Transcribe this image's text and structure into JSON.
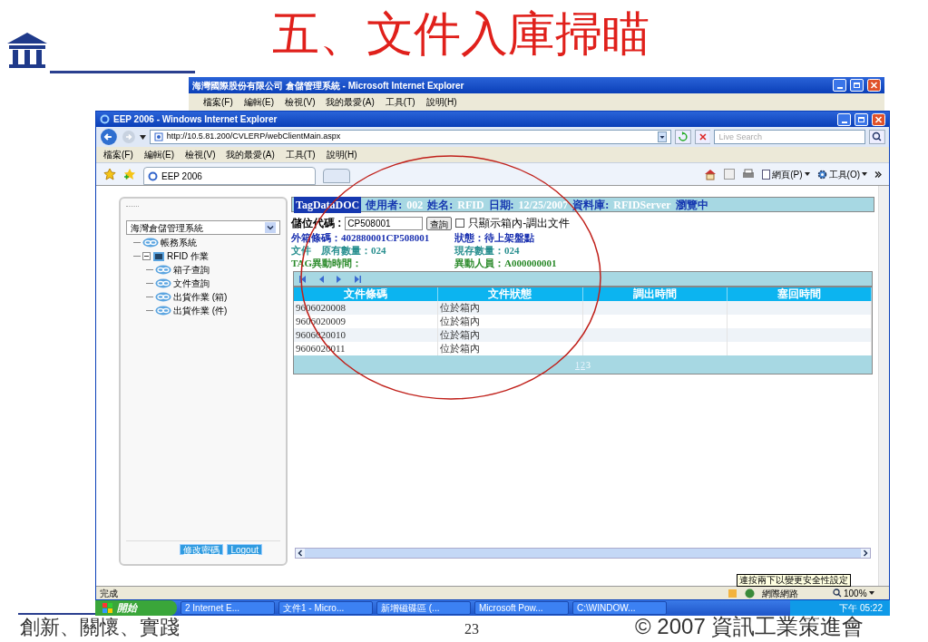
{
  "slide": {
    "title": "五、文件入庫掃瞄",
    "footer_left": "創新、關懷、實踐",
    "page_number": "23",
    "footer_right": "© 2007 資訊工業策進會"
  },
  "back_window": {
    "title": "海灣國際股份有限公司 倉儲管理系統 - Microsoft Internet Explorer",
    "menu": [
      "檔案(F)",
      "編輯(E)",
      "檢視(V)",
      "我的最愛(A)",
      "工具(T)",
      "說明(H)"
    ]
  },
  "browser": {
    "title": "EEP 2006 - Windows Internet Explorer",
    "address": "http://10.5.81.200/CVLERP/webClientMain.aspx",
    "search_placeholder": "Live Search",
    "menu": [
      "檔案(F)",
      "編輯(E)",
      "檢視(V)",
      "我的最愛(A)",
      "工具(T)",
      "說明(H)"
    ],
    "tab": "EEP 2006",
    "toolbar": [
      "網頁(P)",
      "工具(O)"
    ],
    "status": "完成",
    "zone": "網際網路",
    "zoom": "100%",
    "tooltip": "連按兩下以變更安全性設定"
  },
  "sidebar": {
    "system": "海灣倉儲管理系統",
    "tree": [
      {
        "label": "帳務系統"
      },
      {
        "label": "RFID 作業",
        "expanded": true,
        "children": [
          {
            "label": "箱子查詢"
          },
          {
            "label": "文件查詢"
          },
          {
            "label": "出貨作業 (箱)"
          },
          {
            "label": "出貨作業 (件)"
          }
        ]
      }
    ],
    "buttons": [
      "修改密碼",
      "Logout"
    ]
  },
  "header": {
    "app": "TagDataDOC",
    "fields": [
      {
        "label": "使用者:",
        "value": "002"
      },
      {
        "label": "姓名:",
        "value": "RFID"
      },
      {
        "label": "日期:",
        "value": "12/25/2007"
      },
      {
        "label": "資料庫:",
        "value": "RFIDServer"
      }
    ],
    "mode": "瀏覽中"
  },
  "form": {
    "location_label": "儲位代碼 :",
    "location_value": "CP508001",
    "query_button": "查詢",
    "only_in_box": {
      "label": "只顯示箱內-調出文件",
      "checked": false
    }
  },
  "info_lines": [
    {
      "items": [
        "外箱條碼：402880001CP508001",
        "狀態：待上架盤點"
      ]
    },
    {
      "items": [
        "文件　原有數量：024",
        "現存數量：024"
      ]
    },
    {
      "items": [
        "TAG異動時間：",
        "異動人員：A000000001"
      ]
    }
  ],
  "table": {
    "columns": [
      "文件條碼",
      "文件狀態",
      "調出時間",
      "塞回時間"
    ],
    "rows": [
      [
        "9606020008",
        "位於箱內"
      ],
      [
        "9606020009",
        "位於箱內"
      ],
      [
        "9606020010",
        "位於箱內"
      ],
      [
        "9606020011",
        "位於箱內"
      ]
    ],
    "pages": [
      {
        "label": "1",
        "selected": false
      },
      {
        "label": "2",
        "selected": false
      },
      {
        "label": "3",
        "selected": true
      }
    ]
  },
  "taskbar": {
    "start": "開始",
    "items": [
      "2 Internet E...",
      "文件1 - Micro...",
      "新增磁碟區 (...",
      "Microsoft Pow...",
      "C:\\WINDOW..."
    ],
    "clock": "下午 05:22"
  }
}
